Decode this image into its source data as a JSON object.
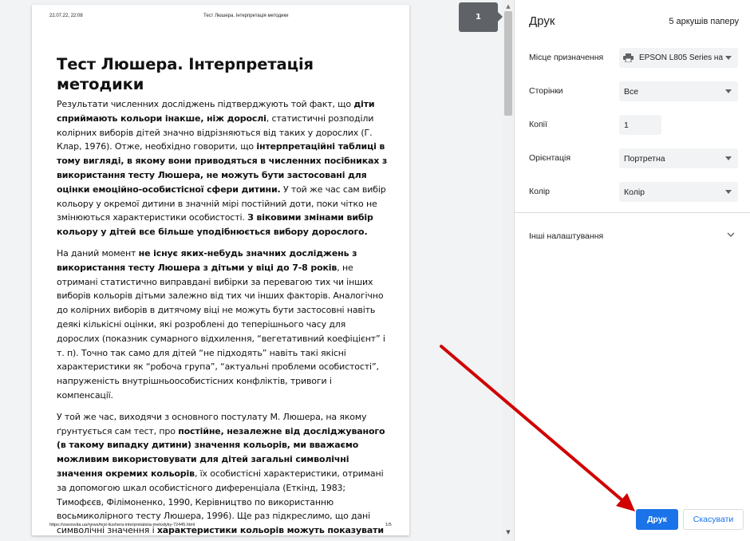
{
  "preview": {
    "header_date": "22.07.22, 22:08",
    "header_title": "Тест Люшера. Інтерпретація методики",
    "footer_url": "https://vseosvita.ua/news/test-liushera-interpretatsiia-metodyky-72445.html",
    "footer_page": "1/5",
    "page_badge": "1"
  },
  "document": {
    "title": "Тест Люшера. Інтерпретація методики",
    "p1": [
      {
        "t": "Результати численних досліджень підтверджують той факт, що "
      },
      {
        "t": "діти сприймають кольори інакше, ніж дорослі",
        "b": true
      },
      {
        "t": ", статистичні розподіли колірних виборів дітей значно відрізняються від таких у дорослих (Г. Клар, 1976). Отже, необхідно говорити, що "
      },
      {
        "t": "інтерпретаційні таблиці в тому вигляді, в якому вони приводяться в численних посібниках з використання тесту Люшера, не можуть бути застосовані для оцінки емоційно-особистісної сфери дитини.",
        "b": true
      },
      {
        "t": " У той же час сам вибір кольору у окремої дитини в значній мірі постійний доти, поки чітко не змінюються характеристики особистості. "
      },
      {
        "t": "З віковими змінами вибір кольору у дітей все більше уподібнюється вибору дорослого.",
        "b": true
      }
    ],
    "p2": [
      {
        "t": "На даний момент "
      },
      {
        "t": "не існує яких-небудь значних досліджень з використання тесту Люшера з дітьми у віці до 7-8 років",
        "b": true
      },
      {
        "t": ", не отримані статистично виправдані вибірки за перевагою тих чи інших виборів кольорів дітьми залежно від тих чи інших факторів. Аналогічно до колірних виборів в дитячому віці не можуть бути застосовні навіть деякі кількісні оцінки, які розроблені до теперішнього часу для дорослих (показник сумарного відхилення, “вегетативний коефіцієнт” і т. п). Точно так само для дітей “не підходять” навіть такі якісні характеристики як “робоча група”, “актуальні проблеми особистості”, напруженість внутрішньоособистісних конфліктів, тривоги і компенсації."
      }
    ],
    "p3": [
      {
        "t": "У той же час, виходячи з основного постулату М. Люшера, на якому ґрунтується сам тест, про "
      },
      {
        "t": "постійне, незалежне від досліджуваного (в такому випадку дитини) значення кольорів, ми вважаємо можливим використовувати для дітей загальні символічні значення окремих кольорів",
        "b": true
      },
      {
        "t": ", їх особистісні характеристики, отримані за допомогою шкал особистісного диференціала (Еткінд, 1983; Тимофєєв, Філімоненко, 1990, Керівництво по використанню восьмиколірного тесту Люшера, 1996). Ще раз підкреслимо, що дані символічні значення і "
      },
      {
        "t": "характеристики кольорів можуть показувати лише загальні тенденції та спрямованості і не більше того.",
        "b": true
      }
    ]
  },
  "panel": {
    "title": "Друк",
    "sheets": "5 аркушів паперу",
    "destination_label": "Місце призначення",
    "destination_value": "EPSON L805 Series на",
    "pages_label": "Сторінки",
    "pages_value": "Все",
    "copies_label": "Копії",
    "copies_value": "1",
    "orientation_label": "Орієнтація",
    "orientation_value": "Портретна",
    "color_label": "Колір",
    "color_value": "Колір",
    "more_settings": "Інші налаштування",
    "print_button": "Друк",
    "cancel_button": "Скасувати"
  },
  "icons": [
    "printer-icon",
    "chevron-down-icon",
    "scroll-up-arrow",
    "scroll-down-arrow"
  ],
  "colors": {
    "accent": "#1a73e8",
    "annotation_arrow": "#d00000"
  }
}
